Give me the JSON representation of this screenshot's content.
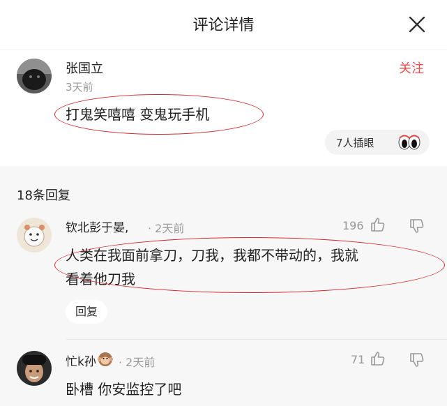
{
  "header": {
    "title": "评论详情"
  },
  "main_comment": {
    "user_name": "张国立",
    "time": "3天前",
    "follow_label": "关注",
    "content": "打鬼笑嘻嘻 变鬼玩手机",
    "insert_label": "7人插眼"
  },
  "replies": {
    "count_label": "18条回复",
    "items": [
      {
        "user_name": "钦北彭于晏,",
        "time": "· 2天前",
        "likes": "196",
        "content_line1": "人类在我面前拿刀，刀我，我都不带动的，我就",
        "content_line2": "看着他刀我",
        "reply_label": "回复"
      },
      {
        "user_name": "忙k孙",
        "time": "· 2天前",
        "likes": "71",
        "content_line1": "卧槽 你安监控了吧"
      }
    ]
  },
  "colors": {
    "accent": "#f04848",
    "annotation": "#d9262b",
    "gray_bg": "#f7f7f7"
  }
}
